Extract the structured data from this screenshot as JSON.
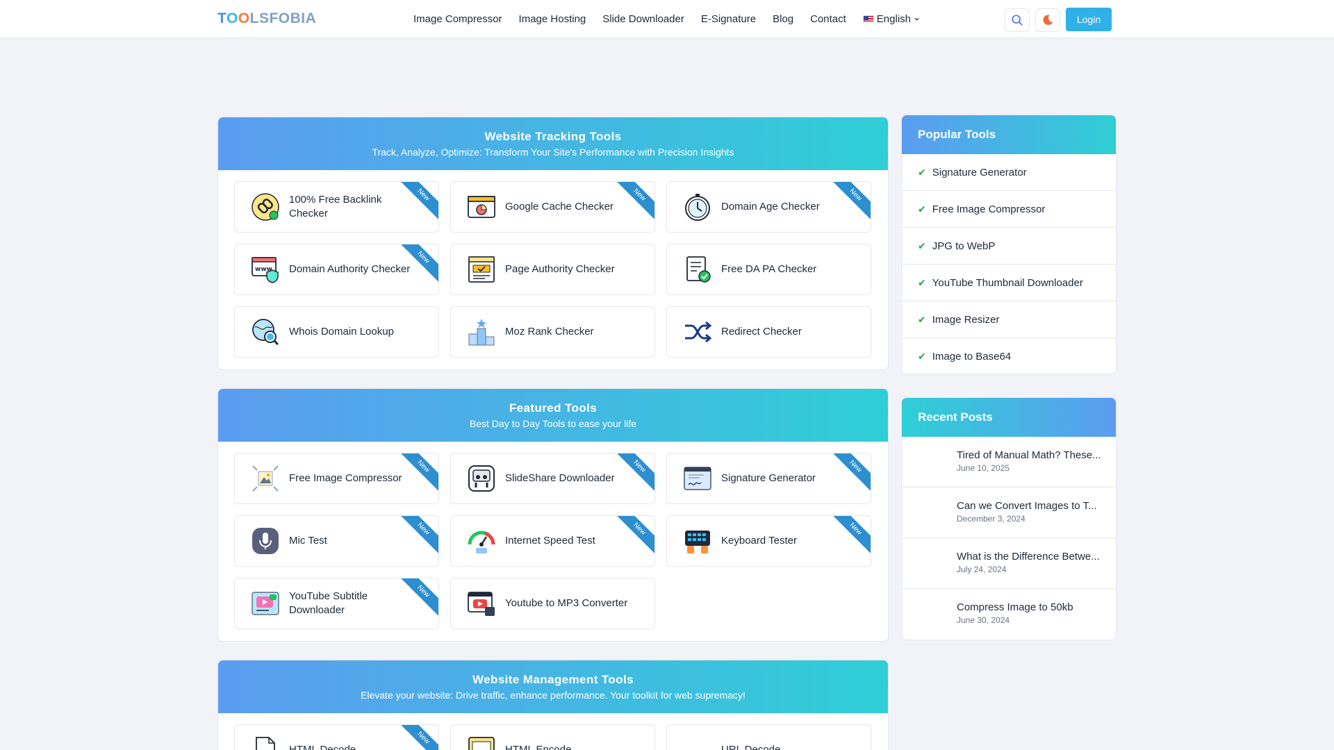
{
  "header": {
    "logo": {
      "p1": "T",
      "p2": "O",
      "p3": "O",
      "p4": "LSFOBIA"
    },
    "nav": [
      "Image Compressor",
      "Image Hosting",
      "Slide Downloader",
      "E-Signature",
      "Blog",
      "Contact"
    ],
    "language": "English",
    "login_label": "Login"
  },
  "ribbon_label": "New",
  "sections": {
    "tracking": {
      "title": "Website Tracking Tools",
      "subtitle": "Track, Analyze, Optimize: Transform Your Site's Performance with Precision Insights",
      "tools": [
        "100% Free Backlink Checker",
        "Google Cache Checker",
        "Domain Age Checker",
        "Domain Authority Checker",
        "Page Authority Checker",
        "Free DA PA Checker",
        "Whois Domain Lookup",
        "Moz Rank Checker",
        "Redirect Checker"
      ]
    },
    "featured": {
      "title": "Featured Tools",
      "subtitle": "Best Day to Day Tools to ease your life",
      "tools": [
        "Free Image Compressor",
        "SlideShare Downloader",
        "Signature Generator",
        "Mic Test",
        "Internet Speed Test",
        "Keyboard Tester",
        "YouTube Subtitle Downloader",
        "Youtube to MP3 Converter"
      ]
    },
    "management": {
      "title": "Website Management Tools",
      "subtitle": "Elevate your website: Drive traffic, enhance performance. Your toolkit for web supremacy!",
      "tools": [
        "HTML Decode",
        "HTML Encode",
        "URL Decode"
      ]
    }
  },
  "popular": {
    "title": "Popular Tools",
    "items": [
      "Signature Generator",
      "Free Image Compressor",
      "JPG to WebP",
      "YouTube Thumbnail Downloader",
      "Image Resizer",
      "Image to Base64"
    ]
  },
  "recent": {
    "title": "Recent Posts",
    "posts": [
      {
        "title": "Tired of Manual Math? These...",
        "date": "June 10, 2025"
      },
      {
        "title": "Can we Convert Images to T...",
        "date": "December 3, 2024"
      },
      {
        "title": "What is the Difference Betwe...",
        "date": "July 24, 2024"
      },
      {
        "title": "Compress Image to 50kb",
        "date": "June 30, 2024"
      }
    ]
  },
  "colors": {
    "accent": "#2fb0e8",
    "gradient_start": "#5b9cf0",
    "gradient_end": "#2fcfd6",
    "ribbon": "#2e8fd0",
    "check": "#22a447"
  },
  "icons": [
    "search-icon",
    "moon-icon",
    "chevron-down-icon",
    "check-icon",
    "flag-us-icon"
  ]
}
